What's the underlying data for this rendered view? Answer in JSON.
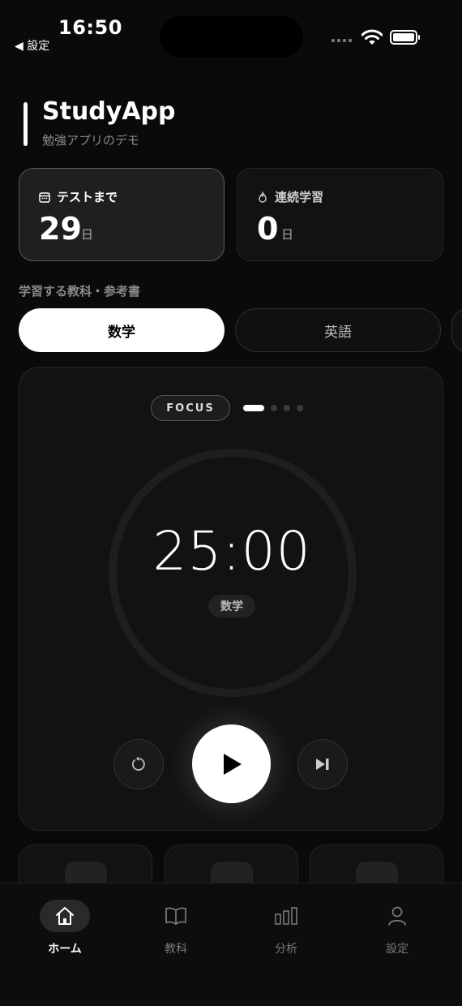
{
  "status_bar": {
    "time": "16:50",
    "back_label": "◀ 設定"
  },
  "header": {
    "title": "StudyApp",
    "subtitle": "勉強アプリのデモ"
  },
  "stats": [
    {
      "label": "テストまで",
      "value": "29",
      "unit": "日",
      "icon": "calendar-icon"
    },
    {
      "label": "連続学習",
      "value": "0",
      "unit": "日",
      "icon": "flame-icon"
    }
  ],
  "subjects": {
    "section_label": "学習する教科・参考書",
    "items": [
      "数学",
      "英語"
    ],
    "selected": "数学"
  },
  "timer": {
    "mode": "FOCUS",
    "page_index": 1,
    "page_count": 4,
    "time": "25:00",
    "subject": "数学"
  },
  "tabs": [
    {
      "label": "ホーム",
      "icon": "home-icon",
      "active": true
    },
    {
      "label": "教科",
      "icon": "book-icon",
      "active": false
    },
    {
      "label": "分析",
      "icon": "bar-chart-icon",
      "active": false
    },
    {
      "label": "設定",
      "icon": "person-icon",
      "active": false
    }
  ],
  "colors": {
    "background": "#0a0a0a",
    "accent": "#ffffff",
    "card": "#121212",
    "muted": "#8a8a8a"
  }
}
